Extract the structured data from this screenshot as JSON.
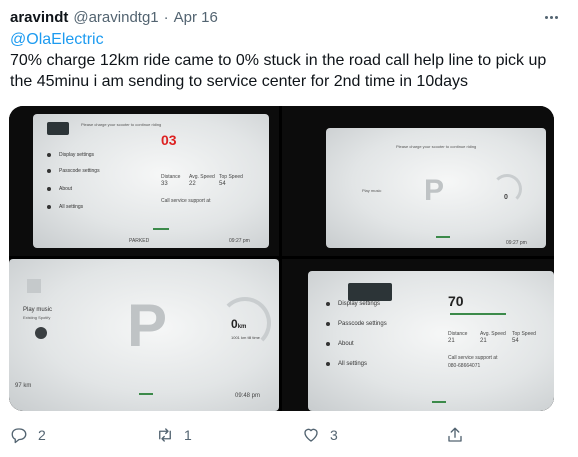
{
  "tweet": {
    "display_name": "aravindt",
    "handle": "@aravindtg1",
    "separator": "·",
    "date": "Apr 16",
    "mention": "@OlaElectric",
    "text": "70% charge 12km ride came to 0% stuck in the road call help line to pick up the 45minu i am sending to service center for 2nd time in 10days"
  },
  "photos": {
    "p1": {
      "banner": "Please charge your scooter to continue riding",
      "charge": "03",
      "menu": [
        "Display settings",
        "Passcode settings",
        "About",
        "All settings"
      ],
      "stats": [
        "Distance",
        "Avg. Speed",
        "Top Speed"
      ],
      "stat_values": [
        "33",
        "22",
        "54"
      ],
      "support": "Call service support at",
      "gear": "PARKED",
      "time": "09:27 pm"
    },
    "p2": {
      "banner": "Please charge your scooter to continue riding",
      "music": "Play music",
      "gear": "P",
      "km": "0",
      "time": "09:27 pm"
    },
    "p3": {
      "music": "Play music",
      "music_sub": "Existing Spotify",
      "gear": "P",
      "km": "0",
      "km_unit": "km",
      "odo": "1001 km till time",
      "range": "97 km",
      "time": "09:48 pm"
    },
    "p4": {
      "charge": "70",
      "menu": [
        "Display settings",
        "Passcode settings",
        "About",
        "All settings"
      ],
      "stats": [
        "Distance",
        "Avg. Speed",
        "Top Speed"
      ],
      "stat_values": [
        "21",
        "21",
        "54"
      ],
      "support": "Call service support at",
      "phone": "080-68664071"
    }
  },
  "actions": {
    "reply_count": "2",
    "retweet_count": "1",
    "like_count": "3"
  }
}
